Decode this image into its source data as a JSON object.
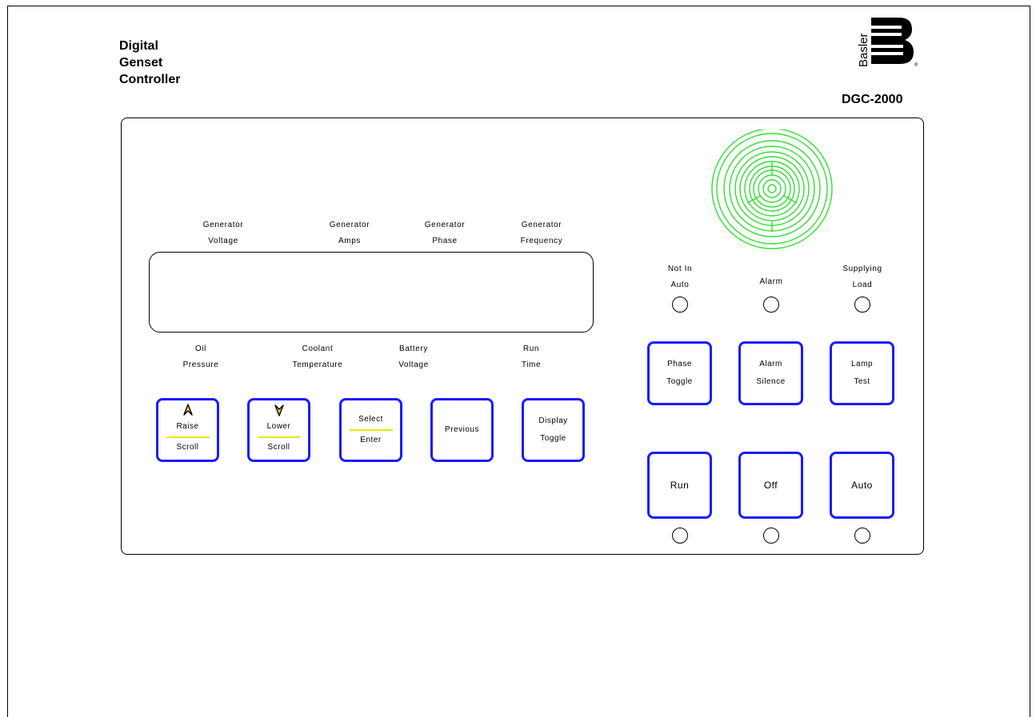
{
  "header": {
    "title_lines": [
      "Digital",
      "Genset",
      "Controller"
    ],
    "model": "DGC-2000",
    "logo_text": "Basler"
  },
  "display_labels_top": [
    {
      "line1": "Generator",
      "line2": "Voltage"
    },
    {
      "line1": "Generator",
      "line2": "Amps"
    },
    {
      "line1": "Generator",
      "line2": "Phase"
    },
    {
      "line1": "Generator",
      "line2": "Frequency"
    }
  ],
  "display_labels_bottom": [
    {
      "line1": "Oil",
      "line2": "Pressure"
    },
    {
      "line1": "Coolant",
      "line2": "Temperature"
    },
    {
      "line1": "Battery",
      "line2": "Voltage"
    },
    {
      "line1": "Run",
      "line2": "Time"
    }
  ],
  "nav_buttons": [
    {
      "top": "Raise",
      "bottom": "Scroll",
      "arrow": "up-arrow-icon"
    },
    {
      "top": "Lower",
      "bottom": "Scroll",
      "arrow": "down-arrow-icon"
    },
    {
      "top": "Select",
      "bottom": "Enter"
    },
    {
      "label": "Previous"
    },
    {
      "top": "Display",
      "bottom": "Toggle"
    }
  ],
  "status_leds": [
    {
      "line1": "Not In",
      "line2": "Auto"
    },
    {
      "line1": "Alarm"
    },
    {
      "line1": "Supplying",
      "line2": "Load"
    }
  ],
  "function_buttons": [
    {
      "top": "Phase",
      "bottom": "Toggle"
    },
    {
      "top": "Alarm",
      "bottom": "Silence"
    },
    {
      "top": "Lamp",
      "bottom": "Test"
    }
  ],
  "mode_buttons": [
    "Run",
    "Off",
    "Auto"
  ],
  "colors": {
    "button_border": "#1a1aff",
    "separator": "#e8e800",
    "horn": "#33dd33"
  }
}
